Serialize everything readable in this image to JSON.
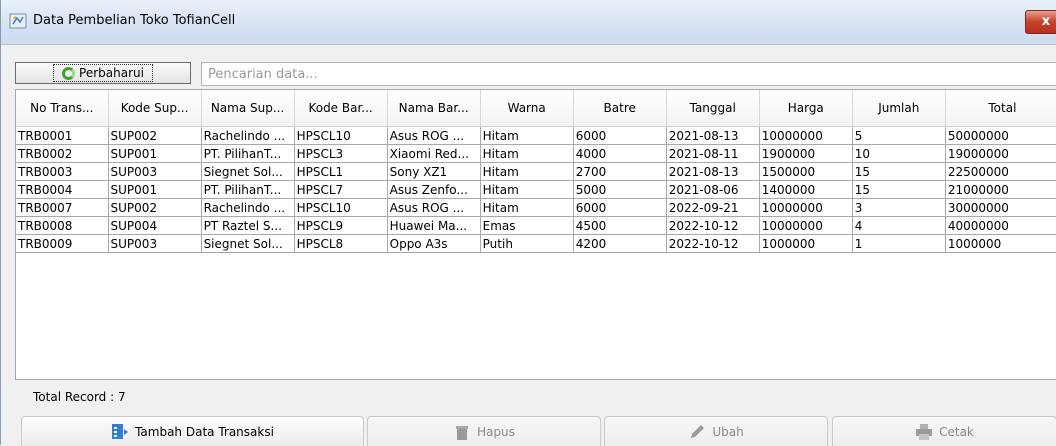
{
  "window": {
    "title": "Data Pembelian Toko TofianCell",
    "close_label": "x"
  },
  "toolbar": {
    "refresh_label": "Perbaharui",
    "search_placeholder": "Pencarian data..."
  },
  "table": {
    "columns": [
      "No Trans...",
      "Kode Sup...",
      "Nama Sup...",
      "Kode Bar...",
      "Nama Bar...",
      "Warna",
      "Batre",
      "Tanggal",
      "Harga",
      "Jumlah",
      "Total"
    ],
    "rows": [
      [
        "TRB0001",
        "SUP002",
        "Rachelindo ...",
        "HPSCL10",
        "Asus ROG ...",
        "Hitam",
        "6000",
        "2021-08-13",
        "10000000",
        "5",
        "50000000"
      ],
      [
        "TRB0002",
        "SUP001",
        "PT. PilihanT...",
        "HPSCL3",
        "Xiaomi Red...",
        "Hitam",
        "4000",
        "2021-08-11",
        "1900000",
        "10",
        "19000000"
      ],
      [
        "TRB0003",
        "SUP003",
        "Siegnet Sol...",
        "HPSCL1",
        "Sony XZ1",
        "Hitam",
        "2700",
        "2021-08-13",
        "1500000",
        "15",
        "22500000"
      ],
      [
        "TRB0004",
        "SUP001",
        "PT. PilihanT...",
        "HPSCL7",
        "Asus Zenfo...",
        "Hitam",
        "5000",
        "2021-08-06",
        "1400000",
        "15",
        "21000000"
      ],
      [
        "TRB0007",
        "SUP002",
        "Rachelindo ...",
        "HPSCL10",
        "Asus ROG ...",
        "Hitam",
        "6000",
        "2022-09-21",
        "10000000",
        "3",
        "30000000"
      ],
      [
        "TRB0008",
        "SUP004",
        "PT Raztel S...",
        "HPSCL9",
        "Huawei Ma...",
        "Emas",
        "4500",
        "2022-10-12",
        "10000000",
        "4",
        "40000000"
      ],
      [
        "TRB0009",
        "SUP003",
        "Siegnet Sol...",
        "HPSCL8",
        "Oppo A3s",
        "Putih",
        "4200",
        "2022-10-12",
        "1000000",
        "1",
        "1000000"
      ]
    ]
  },
  "status": {
    "total_record": "Total Record : 7"
  },
  "actions": {
    "add_label": "Tambah Data Transaksi",
    "delete_label": "Hapus",
    "edit_label": "Ubah",
    "print_label": "Cetak"
  },
  "colors": {
    "accent": "#3da52b",
    "titlebar": "#d5e2f2",
    "close": "#c8412c",
    "add_icon": "#2f7fd6"
  }
}
